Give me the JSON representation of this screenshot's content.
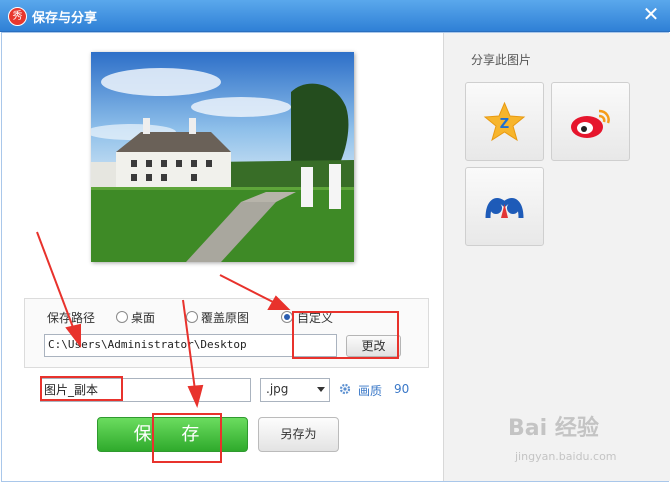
{
  "window": {
    "title": "保存与分享",
    "app_icon_glyph": "秀",
    "close_glyph": "✕"
  },
  "save_path": {
    "label": "保存路径",
    "options": [
      {
        "label": "桌面",
        "selected": false
      },
      {
        "label": "覆盖原图",
        "selected": false
      },
      {
        "label": "自定义",
        "selected": true
      }
    ],
    "path_value": "C:\\Users\\Administrator\\Desktop",
    "change_label": "更改"
  },
  "file": {
    "name_value": "图片_副本",
    "format_value": ".jpg",
    "quality_label": "画质",
    "quality_value": "90"
  },
  "actions": {
    "save_label": "保 存",
    "save_as_label": "另存为"
  },
  "share": {
    "title": "分享此图片",
    "targets": [
      {
        "icon": "qzone-icon"
      },
      {
        "icon": "weibo-icon"
      },
      {
        "icon": "renren-icon"
      }
    ]
  },
  "watermark": {
    "text": "Bai 经验",
    "sub": "jingyan.baidu.com"
  },
  "colors": {
    "titlebar": "#3a8ae0",
    "save_button": "#3cb535",
    "annotation": "#e8322c"
  }
}
